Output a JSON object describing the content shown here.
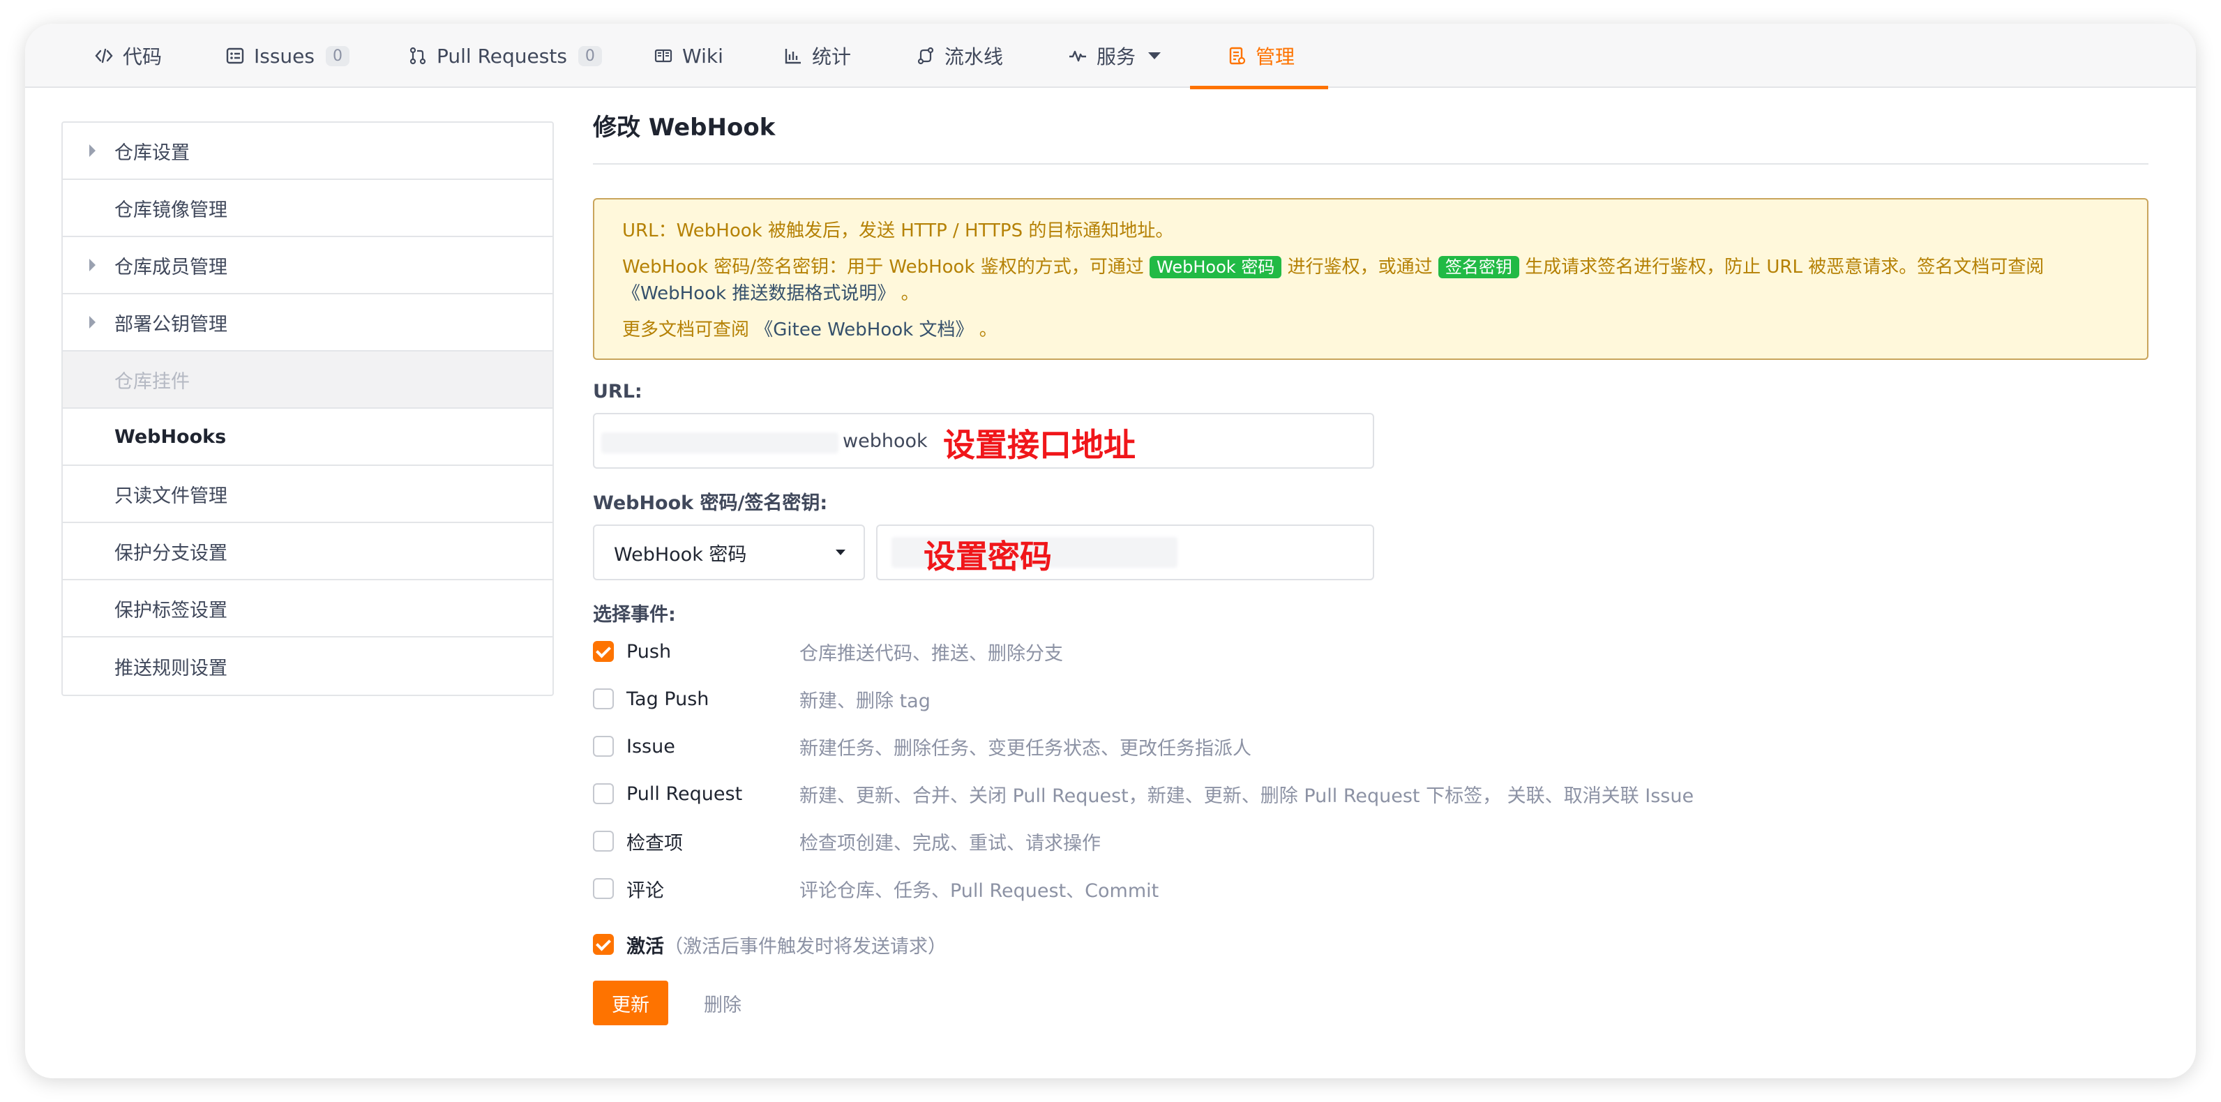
{
  "nav": {
    "tabs": [
      {
        "label": "代码",
        "icon": "code-icon"
      },
      {
        "label": "Issues",
        "icon": "issues-icon",
        "count": "0"
      },
      {
        "label": "Pull Requests",
        "icon": "pull-request-icon",
        "count": "0"
      },
      {
        "label": "Wiki",
        "icon": "wiki-icon"
      },
      {
        "label": "统计",
        "icon": "chart-icon"
      },
      {
        "label": "流水线",
        "icon": "pipeline-icon"
      },
      {
        "label": "服务",
        "icon": "pulse-icon"
      },
      {
        "label": "管理",
        "icon": "manage-icon",
        "active": true
      }
    ]
  },
  "sidebar": {
    "items": [
      {
        "label": "仓库设置"
      },
      {
        "label": "仓库镜像管理"
      },
      {
        "label": "仓库成员管理"
      },
      {
        "label": "部署公钥管理"
      },
      {
        "label": "仓库挂件"
      },
      {
        "label": "WebHooks"
      },
      {
        "label": "只读文件管理"
      },
      {
        "label": "保护分支设置"
      },
      {
        "label": "保护标签设置"
      },
      {
        "label": "推送规则设置"
      }
    ]
  },
  "page": {
    "title": "修改 WebHook"
  },
  "notice": {
    "line1": "URL：WebHook 被触发后，发送 HTTP / HTTPS 的目标通知地址。",
    "line2_a": "WebHook 密码/签名密钥：用于 WebHook 鉴权的方式，可通过 ",
    "badge_password": "WebHook 密码",
    "line2_b": " 进行鉴权，或通过 ",
    "badge_sign": "签名密钥",
    "line2_c": " 生成请求签名进行鉴权，防止 URL 被恶意请求。签名文档可查阅",
    "link_push_doc": "《WebHook 推送数据格式说明》",
    "line2_end": " 。",
    "line3_a": "更多文档可查阅 ",
    "link_gitee_doc": "《Gitee WebHook 文档》",
    "line3_end": " 。"
  },
  "form": {
    "url_label": "URL:",
    "url_value_suffix": "webhook",
    "url_annotation": "设置接口地址",
    "secret_label": "WebHook 密码/签名密钥:",
    "secret_type": "WebHook 密码",
    "secret_annotation": "设置密码",
    "events_label": "选择事件:",
    "events": [
      {
        "name": "Push",
        "desc": "仓库推送代码、推送、删除分支",
        "checked": true
      },
      {
        "name": "Tag Push",
        "desc": "新建、删除 tag",
        "checked": false
      },
      {
        "name": "Issue",
        "desc": "新建任务、删除任务、变更任务状态、更改任务指派人",
        "checked": false
      },
      {
        "name": "Pull Request",
        "desc": "新建、更新、合并、关闭 Pull Request，新建、更新、删除 Pull Request 下标签， 关联、取消关联 Issue",
        "checked": false
      },
      {
        "name": "检查项",
        "desc": "检查项创建、完成、重试、请求操作",
        "checked": false
      },
      {
        "name": "评论",
        "desc": "评论仓库、任务、Pull Request、Commit",
        "checked": false
      }
    ],
    "active_label": "激活",
    "active_hint": "（激活后事件触发时将发送请求）",
    "active_checked": true,
    "update_button": "更新",
    "delete_button": "删除"
  },
  "colors": {
    "accent": "#fe7300",
    "badge_green": "#21ba45",
    "notice_bg": "#fff8db",
    "notice_text": "#b58105",
    "annotation_red": "#f0161a"
  }
}
